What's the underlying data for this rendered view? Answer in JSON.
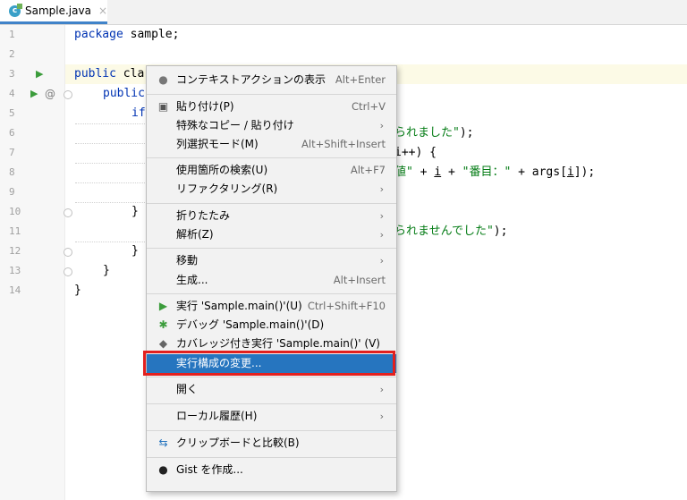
{
  "tab": {
    "filename": "Sample.java",
    "close_glyph": "×"
  },
  "line_numbers": [
    "1",
    "2",
    "3",
    "4",
    "5",
    "6",
    "7",
    "8",
    "9",
    "10",
    "11",
    "12",
    "13",
    "14"
  ],
  "code": {
    "l1_kw": "package",
    "l1_rest": " sample;",
    "l3_kw": "public",
    "l3_rest": " cla",
    "l4_kw": "public",
    "l5_kw": "if",
    "l6_str": "られました\"",
    "l6_rest": ");",
    "l7_rest": "i++) {",
    "l8_str1": "値\"",
    "l8_rest1": " + ",
    "l8_i": "i",
    "l8_rest2": " + ",
    "l8_str2": "\"番目：\"",
    "l8_rest3": " + args[",
    "l8_i2": "i",
    "l8_rest4": "]);",
    "l10_rest": "} ",
    "l11_str": "られませんでした\"",
    "l11_rest": ");",
    "l12_rest": "}",
    "l13_rest": "}",
    "l14_rest": "}"
  },
  "gutter": {
    "run_glyph": "▶",
    "at_glyph": "@"
  },
  "menu": {
    "show_context_actions": {
      "label": "コンテキストアクションの表示",
      "shortcut": "Alt+Enter"
    },
    "paste": {
      "label": "貼り付け(P)",
      "shortcut": "Ctrl+V"
    },
    "paste_special": {
      "label": "特殊なコピー / 貼り付け"
    },
    "column_mode": {
      "label": "列選択モード(M)",
      "shortcut": "Alt+Shift+Insert"
    },
    "find_usages": {
      "label": "使用箇所の検索(U)",
      "shortcut": "Alt+F7"
    },
    "refactor": {
      "label": "リファクタリング(R)"
    },
    "folding": {
      "label": "折りたたみ"
    },
    "analyze": {
      "label": "解析(Z)"
    },
    "goto": {
      "label": "移動"
    },
    "generate": {
      "label": "生成...",
      "shortcut": "Alt+Insert"
    },
    "run": {
      "label": "実行 'Sample.main()'(U)",
      "shortcut": "Ctrl+Shift+F10"
    },
    "debug": {
      "label": "デバッグ 'Sample.main()'(D)"
    },
    "coverage": {
      "label": "カバレッジ付き実行  'Sample.main()' (V)"
    },
    "edit_config": {
      "label": "実行構成の変更..."
    },
    "open": {
      "label": "開く"
    },
    "local_history": {
      "label": "ローカル履歴(H)"
    },
    "compare_clipboard": {
      "label": "クリップボードと比較(B)"
    },
    "create_gist": {
      "label": "Gist を作成..."
    },
    "arrow_glyph": "›"
  },
  "colors": {
    "selection": "#2675bf",
    "highlight_box": "#e3201e",
    "keyword": "#0033b3",
    "string": "#067d17"
  }
}
